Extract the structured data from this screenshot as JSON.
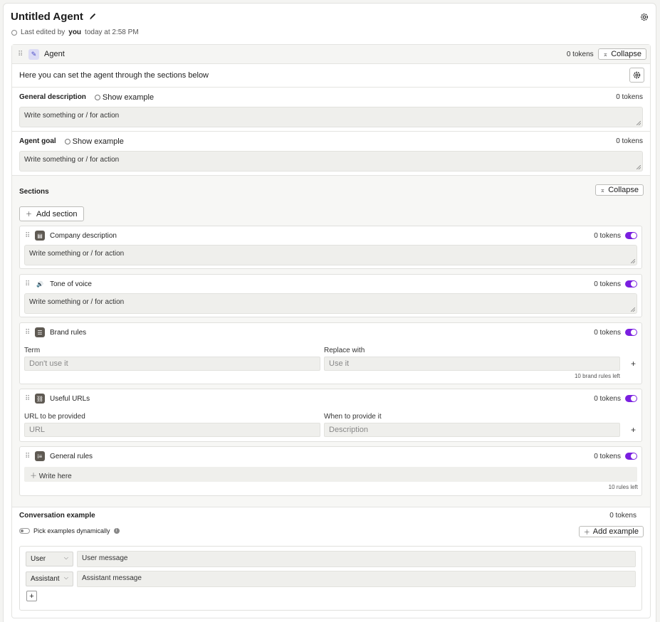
{
  "header": {
    "title": "Untitled Agent",
    "edited_prefix": "Last edited by",
    "edited_by": "you",
    "edited_suffix": "today at 2:58 PM"
  },
  "agent": {
    "label": "Agent",
    "tokens": "0 tokens",
    "collapse_label": "Collapse",
    "intro": "Here you can set the agent through the sections below",
    "general_description": {
      "label": "General description",
      "show_example": "Show example",
      "tokens": "0 tokens",
      "placeholder": "Write something or / for action"
    },
    "agent_goal": {
      "label": "Agent goal",
      "show_example": "Show example",
      "tokens": "0 tokens",
      "placeholder": "Write something or / for action"
    }
  },
  "sections": {
    "label": "Sections",
    "collapse_label": "Collapse",
    "add_section": "Add section",
    "company": {
      "label": "Company description",
      "tokens": "0 tokens",
      "placeholder": "Write something or / for action",
      "enabled": true
    },
    "tone": {
      "label": "Tone of voice",
      "tokens": "0 tokens",
      "placeholder": "Write something or / for action",
      "enabled": true
    },
    "brand": {
      "label": "Brand rules",
      "tokens": "0 tokens",
      "enabled": true,
      "term_label": "Term",
      "term_placeholder": "Don't use it",
      "replace_label": "Replace with",
      "replace_placeholder": "Use it",
      "left": "10 brand rules left"
    },
    "urls": {
      "label": "Useful URLs",
      "tokens": "0 tokens",
      "enabled": true,
      "url_label": "URL to be provided",
      "url_placeholder": "URL",
      "when_label": "When to provide it",
      "when_placeholder": "Description"
    },
    "general_rules": {
      "label": "General rules",
      "tokens": "0 tokens",
      "enabled": true,
      "write_here": "Write here",
      "left": "10 rules left"
    }
  },
  "conversation": {
    "label": "Conversation example",
    "tokens": "0 tokens",
    "pick_dynamic": "Pick examples dynamically",
    "pick_enabled": false,
    "add_example": "Add example",
    "rows": [
      {
        "role": "User",
        "message": "User  message"
      },
      {
        "role": "Assistant",
        "message": "Assistant  message"
      }
    ]
  },
  "colors": {
    "accent": "#7a1fe0",
    "agent_icon_bg": "#dcdcf5"
  }
}
